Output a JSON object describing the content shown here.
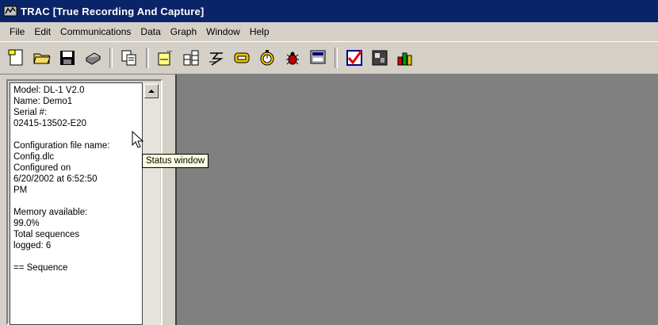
{
  "window": {
    "title": "TRAC [True Recording And Capture]"
  },
  "menu": [
    {
      "label": "File"
    },
    {
      "label": "Edit"
    },
    {
      "label": "Communications"
    },
    {
      "label": "Data"
    },
    {
      "label": "Graph"
    },
    {
      "label": "Window"
    },
    {
      "label": "Help"
    }
  ],
  "toolbar": {
    "icons": [
      "new-file-icon",
      "open-folder-icon",
      "save-icon",
      "print-icon",
      "copy-icon",
      "edit-config-icon",
      "channel-grid-icon",
      "waveform-icon",
      "connect-icon",
      "timer-icon",
      "bug-icon",
      "monitor-icon",
      "checkmark-icon",
      "chart-image-icon",
      "bar-graph-icon"
    ]
  },
  "status": {
    "lines": [
      "Model: DL-1 V2.0",
      "Name: Demo1",
      "Serial #:",
      "02415-13502-E20",
      "",
      "Configuration file name:",
      "Config.dlc",
      "Configured on",
      "6/20/2002 at 6:52:50",
      "PM",
      "",
      "Memory available:",
      "99.0%",
      "Total sequences",
      "logged: 6",
      "",
      "== Sequence"
    ]
  },
  "tooltip": {
    "text": "Status window"
  },
  "colors": {
    "titlebar": "#0a246a",
    "face": "#d4d0c8",
    "mdi_background": "#808080",
    "tooltip": "#ffffe1"
  }
}
